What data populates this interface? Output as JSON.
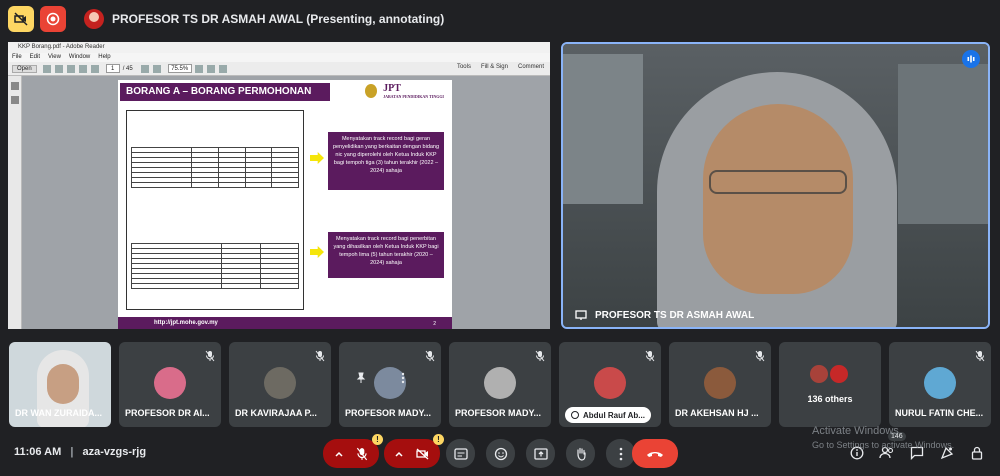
{
  "presenter": {
    "label": "PROFESOR TS DR ASMAH AWAL (Presenting, annotating)"
  },
  "pdf_window": {
    "title": "KKP Borang.pdf - Adobe Reader",
    "menu": [
      "File",
      "Edit",
      "View",
      "Window",
      "Help"
    ],
    "open_label": "Open",
    "page_current": "1",
    "page_total": "/ 45",
    "zoom": "75.5%",
    "right_tools": [
      "Tools",
      "Fill & Sign",
      "Comment"
    ]
  },
  "document": {
    "title": "BORANG A – BORANG PERMOHONAN KKP",
    "logo_text": "JPT",
    "logo_sub": "JABATAN PENDIDIKAN TINGGI",
    "box1": "Menyatakan track record bagi geran penyelidikan yang berkaitan dengan bidang nic yang diperolehi oleh Ketua Induk KKP bagi tempoh tiga (3) tahun terakhir (2022 – 2024) sahaja",
    "box2": "Menyatakan track record bagi penerbitan yang dihasilkan oleh Ketua Induk KKP bagi tempoh lima (5) tahun terakhir (2020 – 2024) sahaja",
    "footer_url": "http://jpt.mohe.gov.my",
    "page_number": "2"
  },
  "speaker": {
    "name": "PROFESOR TS DR ASMAH AWAL"
  },
  "tiles": [
    {
      "name": "DR WAN ZURAIDA..."
    },
    {
      "name": "PROFESOR DR AI..."
    },
    {
      "name": "DR KAVIRAJAA P..."
    },
    {
      "name": "PROFESOR MADY..."
    },
    {
      "name": "PROFESOR MADY..."
    },
    {
      "name": "Abdul Rauf Ab..."
    },
    {
      "name": "DR AKEHSAN HJ ..."
    },
    {
      "name": "136 others"
    },
    {
      "name": "NURUL FATIN CHE..."
    }
  ],
  "meeting": {
    "time": "11:06 AM",
    "code": "aza-vzgs-rjg"
  },
  "people_count": "146",
  "activation": {
    "title": "Activate Windows",
    "subtitle": "Go to Settings to activate Windows."
  },
  "colors": {
    "accent": "#8ab4f8",
    "danger": "#ea4335",
    "doc_purple": "#5b1b5e",
    "warn": "#fdd663"
  }
}
